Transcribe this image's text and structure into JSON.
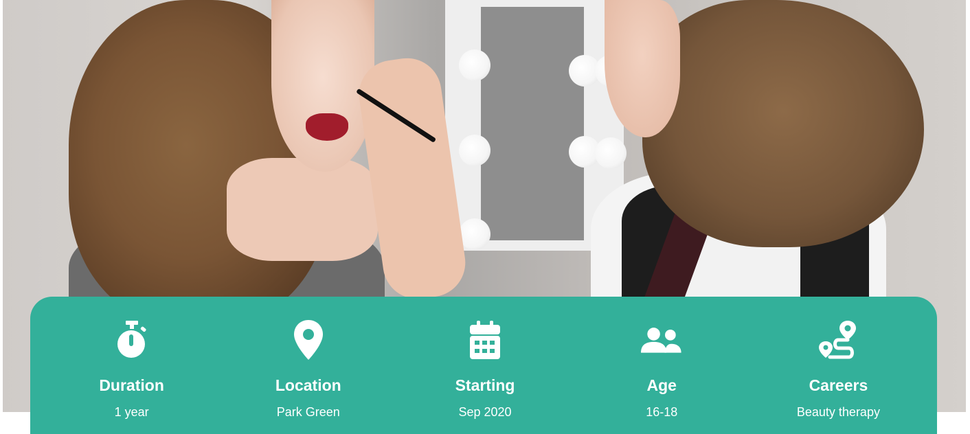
{
  "colors": {
    "panel": "#33b09a",
    "text": "#ffffff"
  },
  "hero": {
    "image": "makeup-artist-applying-eyeliner-photo"
  },
  "info": [
    {
      "icon": "stopwatch-icon",
      "title": "Duration",
      "value": "1 year"
    },
    {
      "icon": "map-pin-icon",
      "title": "Location",
      "value": "Park Green"
    },
    {
      "icon": "calendar-icon",
      "title": "Starting",
      "value": "Sep 2020"
    },
    {
      "icon": "users-icon",
      "title": "Age",
      "value": "16-18"
    },
    {
      "icon": "route-icon",
      "title": "Careers",
      "value": "Beauty therapy"
    }
  ]
}
